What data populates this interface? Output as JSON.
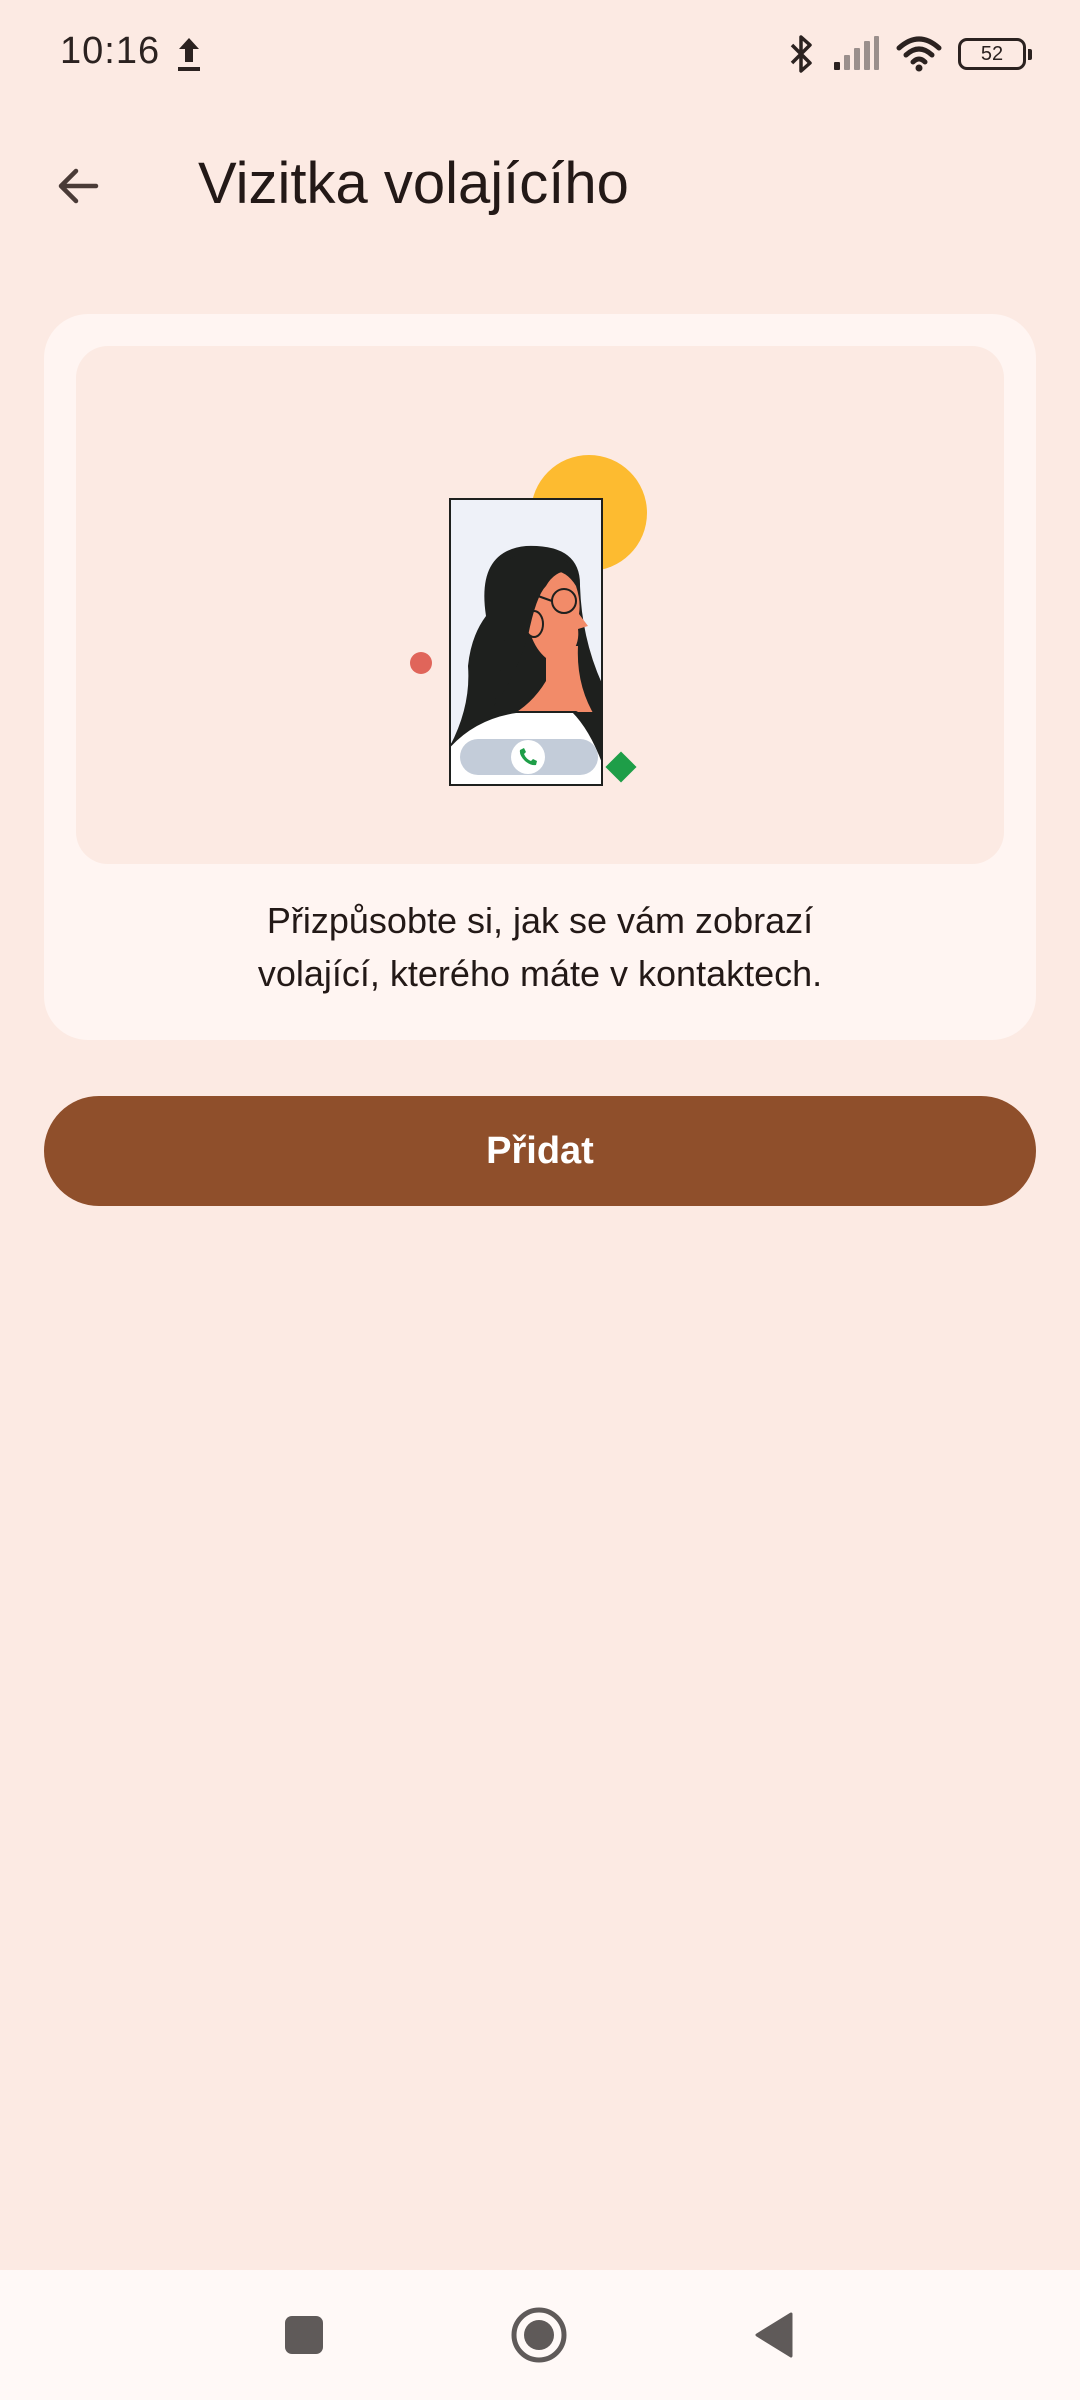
{
  "status_bar": {
    "time": "10:16",
    "battery_level": "52",
    "icons": [
      "upload-icon",
      "bluetooth-icon",
      "signal-icon",
      "wifi-icon",
      "battery-icon"
    ]
  },
  "app_bar": {
    "back_icon": "arrow-back-icon",
    "title": "Vizitka volajícího"
  },
  "card": {
    "illustration": "caller-card-illustration",
    "description_line1": "Přizpůsobte si, jak se vám zobrazí",
    "description_line2": "volající, kterého máte v kontaktech."
  },
  "primary_button": {
    "label": "Přidat"
  },
  "nav_bar": {
    "items": [
      "recents-square-icon",
      "home-circle-icon",
      "back-triangle-icon"
    ]
  },
  "colors": {
    "background": "#FCEAE3",
    "card": "#FFF5F2",
    "accent": "#8F4F2B",
    "sun": "#FDBB30",
    "skin": "#F28B69",
    "hair": "#1E201E",
    "green": "#1E9E48",
    "red_dot": "#E0655A"
  }
}
